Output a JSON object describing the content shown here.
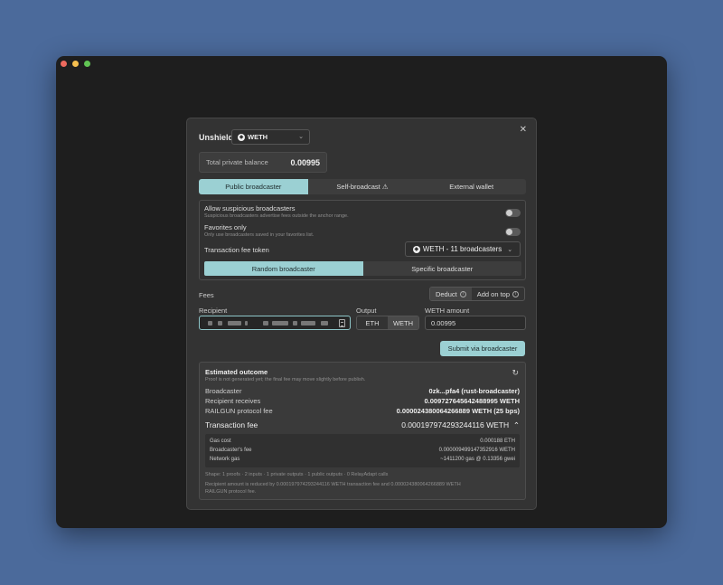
{
  "modal": {
    "title": "Unshield",
    "token": "WETH",
    "balance": {
      "label": "Total private balance",
      "value": "0.00995"
    },
    "tabs": [
      {
        "label": "Public broadcaster",
        "active": true
      },
      {
        "label": "Self-broadcast",
        "warning": "⚠",
        "active": false
      },
      {
        "label": "External wallet",
        "active": false
      }
    ],
    "settings": {
      "allow_suspicious": {
        "title": "Allow suspicious broadcasters",
        "subtitle": "Suspicious broadcasters advertise fees outside the anchor range."
      },
      "favorites": {
        "title": "Favorites only",
        "subtitle": "Only use broadcasters saved in your favorites list."
      },
      "fee_token_label": "Transaction fee token",
      "fee_token_value": "WETH - 11 broadcasters",
      "subtabs": [
        {
          "label": "Random broadcaster",
          "active": true
        },
        {
          "label": "Specific broadcaster",
          "active": false
        }
      ]
    },
    "fees": {
      "label": "Fees",
      "modes": [
        {
          "label": "Deduct",
          "active": true
        },
        {
          "label": "Add on top",
          "active": false
        }
      ]
    },
    "recipient_label": "Recipient",
    "output": {
      "label": "Output",
      "options": [
        {
          "label": "ETH",
          "active": false
        },
        {
          "label": "WETH",
          "active": true
        }
      ]
    },
    "amount": {
      "label": "WETH amount",
      "value": "0.00995"
    },
    "submit_label": "Submit via broadcaster",
    "outcome": {
      "title": "Estimated outcome",
      "subtitle": "Proof is not generated yet; the final fee may move slightly before publish.",
      "rows": [
        {
          "label": "Broadcaster",
          "value": "0zk...pfa4 (rust-broadcaster)"
        },
        {
          "label": "Recipient receives",
          "value": "0.009727645642488995 WETH"
        },
        {
          "label": "RAILGUN protocol fee",
          "value": "0.000024380064266889 WETH (25 bps)"
        }
      ],
      "tx_fee_label": "Transaction fee",
      "tx_fee_value": "0.000197974293244116 WETH",
      "breakdown": [
        {
          "label": "Gas cost",
          "value": "0.000188 ETH"
        },
        {
          "label": "Broadcaster's fee",
          "value": "0.000009499147352916 WETH"
        },
        {
          "label": "Network gas",
          "value": "~1411200 gas @ 0.13356 gwei"
        }
      ],
      "shape": "Shape: 1 proofs · 2 inputs · 1 private outputs · 1 public outputs · 0 RelayAdapt calls",
      "note_line1": "Recipient amount is reduced by 0.000197974293244116 WETH transaction fee and 0.000024380064266889 WETH",
      "note_line2": "RAILGUN protocol fee."
    }
  }
}
